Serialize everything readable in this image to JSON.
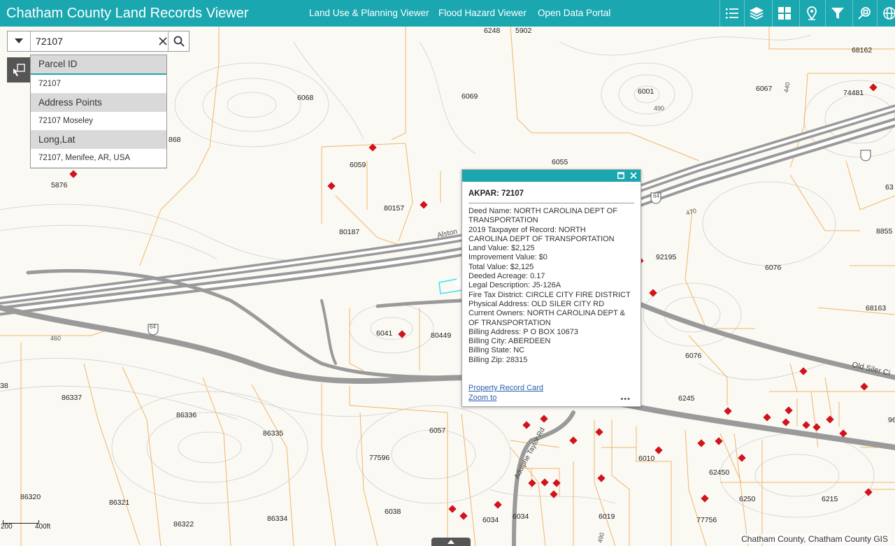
{
  "header": {
    "title": "Chatham County Land Records Viewer",
    "nav": [
      "Land Use & Planning Viewer",
      "Flood Hazard Viewer",
      "Open Data Portal"
    ],
    "tools": [
      "list-icon",
      "layers-icon",
      "basemap-grid-icon",
      "location-pin-icon",
      "filter-icon",
      "query-search-icon",
      "globe-icon"
    ],
    "accent_color": "#1aa7b0"
  },
  "search": {
    "value": "72107",
    "suggestions": [
      {
        "group": "Parcel ID",
        "item": "72107"
      },
      {
        "group": "Address Points",
        "item": "72107 Moseley"
      },
      {
        "group": "Long,Lat",
        "item": "72107, Menifee, AR, USA"
      }
    ]
  },
  "popup": {
    "title": "AKPAR: 72107",
    "lines": [
      "Deed Name:  NORTH CAROLINA DEPT OF",
      "TRANSPORTATION",
      "2019 Taxpayer of Record:  NORTH",
      "CAROLINA DEPT OF TRANSPORTATION",
      "Land Value:  $2,125",
      "Improvement Value:  $0",
      "Total Value:  $2,125",
      "Deeded Acreage: 0.17",
      "Legal Description:  J5-126A",
      "Fire Tax District:  CIRCLE CITY FIRE DISTRICT",
      "Physical Address:  OLD SILER CITY RD",
      "Current Owners:  NORTH CAROLINA DEPT &",
      "OF TRANSPORTATION",
      "Billing Address:  P O BOX 10673",
      "Billing City:  ABERDEEN",
      "Billing State:  NC",
      "Billing Zip:  28315"
    ],
    "links": [
      "Property Record Card",
      "Zoom to"
    ],
    "more": "•••"
  },
  "map": {
    "parcel_labels": [
      "6248",
      "5902",
      "68162",
      "74481",
      "6001",
      "6067",
      "6068",
      "6069",
      "868",
      "6059",
      "6055",
      "5876",
      "80157",
      "80187",
      "92195",
      "6076",
      "8855",
      "68163",
      "6041",
      "80449",
      "6076",
      "6245",
      "38",
      "86337",
      "86336",
      "86335",
      "6057",
      "77596",
      "6010",
      "62450",
      "86320",
      "86321",
      "6038",
      "6034",
      "6034",
      "6019",
      "6250",
      "6215",
      "86322",
      "86334",
      "77756",
      "63",
      "96"
    ],
    "road_labels": [
      "Alston",
      "64",
      "64",
      "470",
      "460",
      "440",
      "490",
      "Old Siler Ci",
      "Adolphe Taylor Rd",
      "490"
    ],
    "scale": {
      "left": "200",
      "right": "400ft"
    },
    "attribution": "Chatham County, Chatham County GIS"
  }
}
